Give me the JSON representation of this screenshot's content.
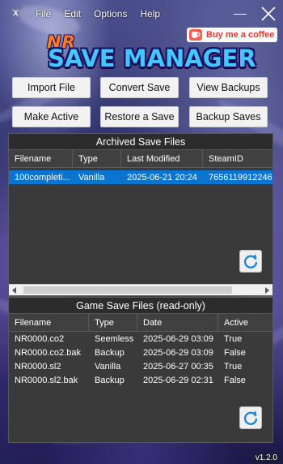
{
  "menu": {
    "file": "File",
    "edit": "Edit",
    "options": "Options",
    "help": "Help"
  },
  "coffee": {
    "label": "Buy me a coffee"
  },
  "logo": {
    "prefix": "NR",
    "main": "SAVE MANAGER"
  },
  "buttons": {
    "import_file": "Import File",
    "convert_save": "Convert Save",
    "view_backups": "View Backups",
    "make_active": "Make Active",
    "restore_save": "Restore a Save",
    "backup_saves": "Backup Saves"
  },
  "archived": {
    "title": "Archived Save Files",
    "columns": [
      "Filename",
      "Type",
      "Last Modified",
      "SteamID"
    ],
    "rows": [
      [
        "100completi...",
        "Vanilla",
        "2025-06-21 20:24",
        "7656119912246"
      ]
    ]
  },
  "game": {
    "title": "Game Save Files (read-only)",
    "columns": [
      "Filename",
      "Type",
      "Date",
      "Active"
    ],
    "rows": [
      [
        "NR0000.co2",
        "Seemless",
        "2025-06-29 03:09",
        "True"
      ],
      [
        "NR0000.co2.bak",
        "Backup",
        "2025-06-29 03:09",
        "False"
      ],
      [
        "NR0000.sl2",
        "Vanilla",
        "2025-06-27 00:35",
        "True"
      ],
      [
        "NR0000.sl2.bak",
        "Backup",
        "2025-06-29 02:31",
        "False"
      ]
    ]
  },
  "version": "v1.2.0",
  "colors": {
    "selection": "#0a74cf",
    "logo_blue": "#44c6ff",
    "logo_orange": "#ff7a2a",
    "coffee_red": "#ff5c55"
  },
  "icons": {
    "app": "app-icon",
    "minimize": "minimize-icon",
    "close": "close-icon",
    "refresh": "refresh-icon",
    "coffee": "coffee-cup-icon"
  }
}
